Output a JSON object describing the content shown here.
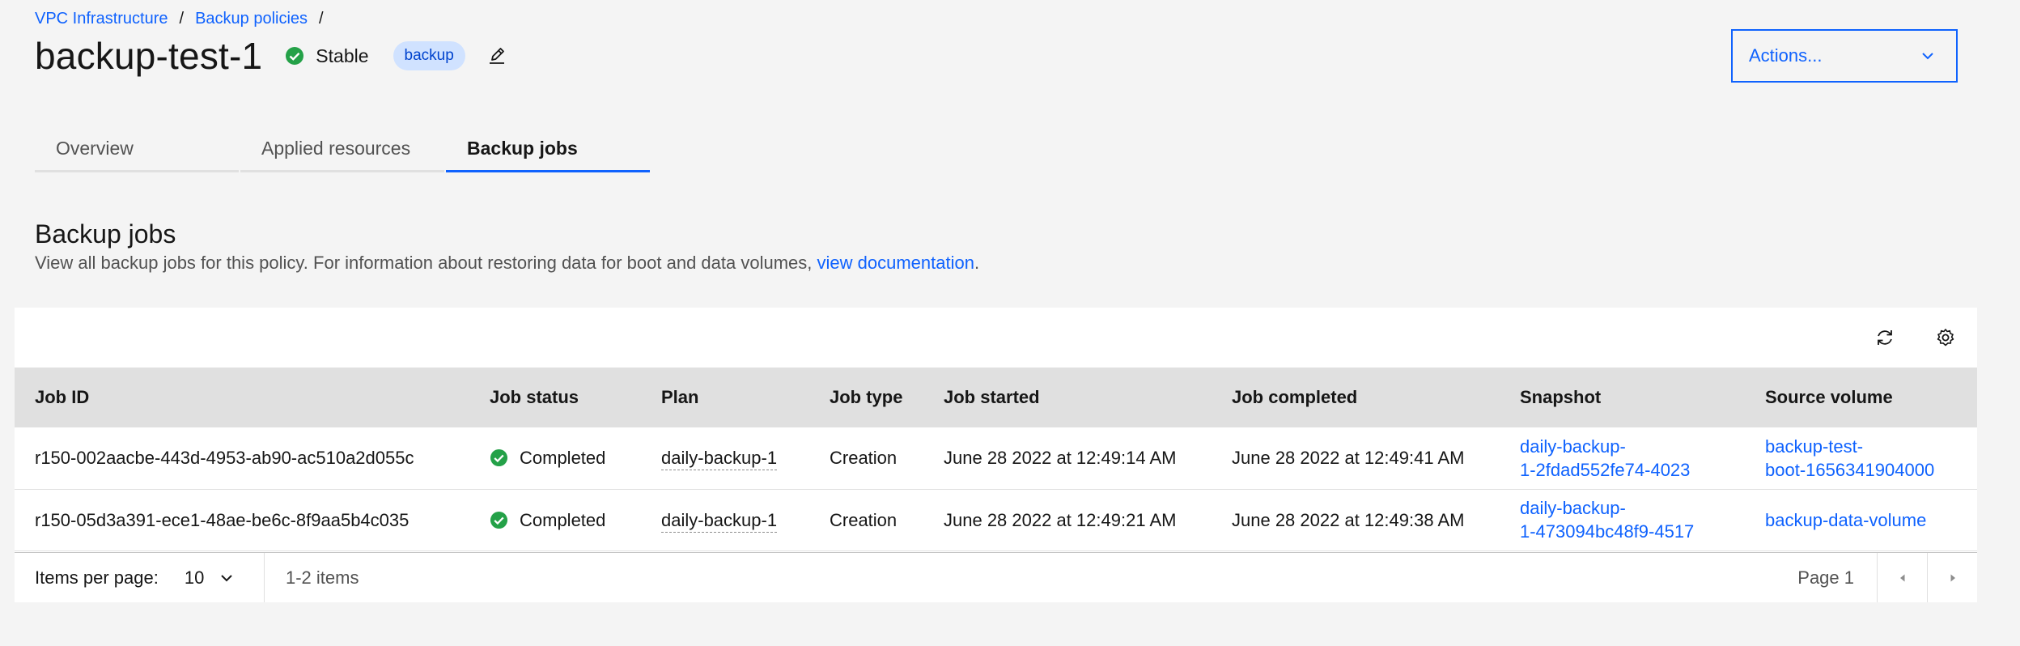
{
  "breadcrumb": {
    "items": [
      "VPC Infrastructure",
      "Backup policies"
    ],
    "separator": "/"
  },
  "header": {
    "title": "backup-test-1",
    "status": "Stable",
    "tag": "backup"
  },
  "actions": {
    "label": "Actions..."
  },
  "tabs": [
    {
      "label": "Overview",
      "active": false
    },
    {
      "label": "Applied resources",
      "active": false
    },
    {
      "label": "Backup jobs",
      "active": true
    }
  ],
  "section": {
    "title": "Backup jobs",
    "description_prefix": "View all backup jobs for this policy. For information about restoring data for boot and data volumes, ",
    "description_link": "view documentation",
    "description_suffix": "."
  },
  "table": {
    "columns": [
      "Job ID",
      "Job status",
      "Plan",
      "Job type",
      "Job started",
      "Job completed",
      "Snapshot",
      "Source volume"
    ],
    "rows": [
      {
        "job_id": "r150-002aacbe-443d-4953-ab90-ac510a2d055c",
        "status": "Completed",
        "plan": "daily-backup-1",
        "type": "Creation",
        "started": "June 28 2022 at 12:49:14 AM",
        "completed": "June 28 2022 at 12:49:41 AM",
        "snapshot": [
          "daily-backup-",
          "1-2fdad552fe74-4023"
        ],
        "source": [
          "backup-test-",
          "boot-1656341904000"
        ]
      },
      {
        "job_id": "r150-05d3a391-ece1-48ae-be6c-8f9aa5b4c035",
        "status": "Completed",
        "plan": "daily-backup-1",
        "type": "Creation",
        "started": "June 28 2022 at 12:49:21 AM",
        "completed": "June 28 2022 at 12:49:38 AM",
        "snapshot": [
          "daily-backup-",
          "1-473094bc48f9-4517"
        ],
        "source": [
          "backup-data-volume"
        ]
      }
    ]
  },
  "pagination": {
    "items_per_page_label": "Items per page:",
    "items_per_page": "10",
    "range": "1-2 items",
    "page": "Page 1"
  },
  "colors": {
    "accent": "#0f62fe",
    "success": "#24a148",
    "tag_bg": "#d0e2ff"
  },
  "icons": {
    "status": "checkmark-filled-icon",
    "edit": "edit-icon",
    "refresh": "refresh-icon",
    "settings": "gear-icon",
    "dropdown": "chevron-down-icon",
    "prev": "caret-left-icon",
    "next": "caret-right-icon"
  }
}
